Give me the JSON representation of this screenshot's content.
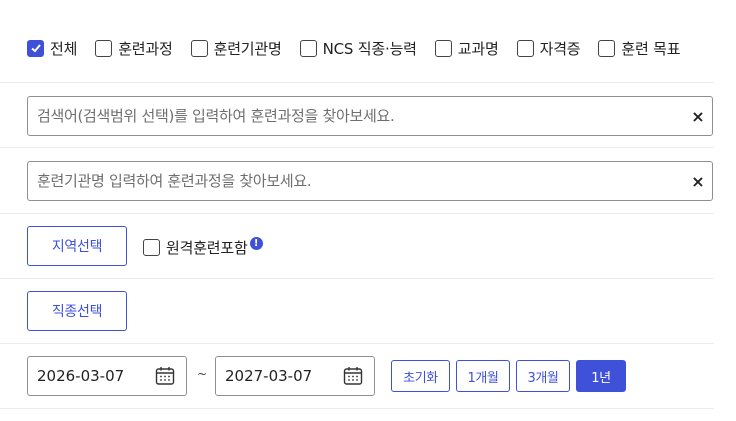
{
  "categories": [
    {
      "label": "전체",
      "checked": true
    },
    {
      "label": "훈련과정",
      "checked": false
    },
    {
      "label": "훈련기관명",
      "checked": false
    },
    {
      "label": "NCS 직종·능력",
      "checked": false
    },
    {
      "label": "교과명",
      "checked": false
    },
    {
      "label": "자격증",
      "checked": false
    },
    {
      "label": "훈련 목표",
      "checked": false
    }
  ],
  "keyword_search": {
    "placeholder": "검색어(검색범위 선택)를 입력하여 훈련과정을 찾아보세요.",
    "value": "",
    "clear_label": "×"
  },
  "institution_search": {
    "placeholder": "훈련기관명 입력하여 훈련과정을 찾아보세요.",
    "value": "",
    "clear_label": "×"
  },
  "region": {
    "button_label": "지역선택",
    "remote_label": "원격훈련포함",
    "remote_checked": false,
    "info_label": "!"
  },
  "job": {
    "button_label": "직종선택"
  },
  "period": {
    "start_date": "2026-03-07",
    "end_date": "2027-03-07",
    "separator": "~",
    "reset_label": "초기화",
    "one_month_label": "1개월",
    "three_month_label": "3개월",
    "one_year_label": "1년",
    "active_range": "1년"
  },
  "colors": {
    "accent": "#3f51d8",
    "border": "#8f8f8f",
    "divider": "#ececec"
  },
  "icons": {
    "check": "check-icon",
    "clear": "close-icon",
    "calendar": "calendar-icon",
    "info": "info-icon"
  }
}
